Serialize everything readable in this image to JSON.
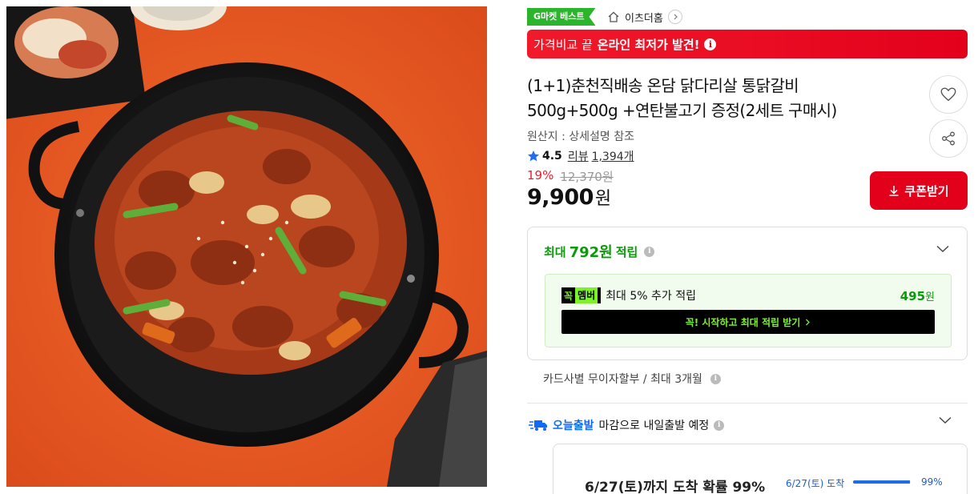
{
  "badge": {
    "text": "G마켓 베스트"
  },
  "store": {
    "name": "이츠더홈"
  },
  "banner": {
    "normal": "가격비교 끝",
    "strong": "온라인 최저가 발견!",
    "info_icon": "i"
  },
  "product": {
    "title_line1": "(1+1)춘천직배송 온담 닭다리살 통닭갈비",
    "title_line2": "500g+500g +연탄불고기 증정(2세트 구매시)",
    "origin": "원산지 : 상세설명 참조",
    "rating": "4.5",
    "review_label": "리뷰",
    "review_count": "1,394개",
    "discount": "19%",
    "original_price": "12,370원",
    "sale_price": "9,900",
    "sale_unit": "원"
  },
  "coupon": {
    "label": "쿠폰받기"
  },
  "points": {
    "prefix": "최대",
    "amount": "792원",
    "suffix": "적립",
    "info_icon": "i",
    "member_badge_k": "꼭",
    "member_badge_m": "멤버",
    "member_text": "최대 5% 추가 적립",
    "member_amount": "495",
    "member_unit": "원",
    "member_cta": "꼭! 시작하고 최대 적립 받기"
  },
  "installment": {
    "text": "카드사별 무이자할부 / 최대 3개월",
    "info_icon": "i"
  },
  "delivery": {
    "brand": "오늘출발",
    "text": "마감으로 내일출발 예정",
    "info_icon": "i",
    "arrival_title": "6/27(토)까지 도착 확률 99%",
    "arrival_date": "6/27(토) 도착",
    "arrival_pct_label": "99%",
    "arrival_fraction": 0.99
  },
  "colors": {
    "accent_red": "#e3001b",
    "green": "#0a9b0a",
    "blue": "#0f6bf4",
    "badge_green": "#2cb52c",
    "neon": "#7df22b"
  },
  "icons": [
    "home-icon",
    "chevron-right-icon",
    "heart-icon",
    "share-icon",
    "star-icon",
    "download-icon",
    "chevron-down-icon",
    "truck-icon",
    "info-icon"
  ]
}
